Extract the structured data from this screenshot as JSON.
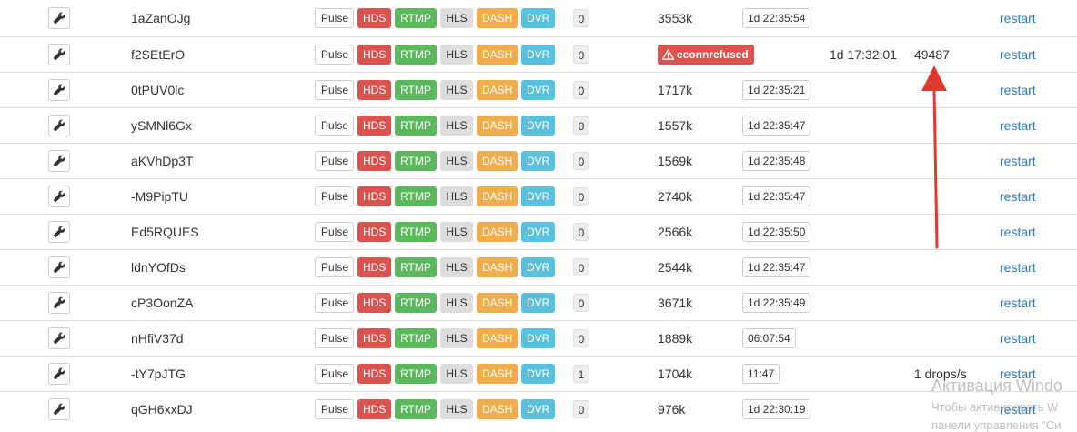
{
  "buttons": {
    "pulse": "Pulse",
    "hds": "HDS",
    "rtmp": "RTMP",
    "hls": "HLS",
    "dash": "DASH",
    "dvr": "DVR"
  },
  "restart_label": "restart",
  "colors": {
    "hds": "#d9534f",
    "rtmp": "#5cb85c",
    "hls": "#dddddd",
    "dash": "#f0ad4e",
    "dvr": "#5bc0de",
    "link": "#337ab7",
    "arrow": "#e03a2f"
  },
  "icons": {
    "settings": "wrench-icon",
    "error": "warning-triangle-icon"
  },
  "streams": [
    {
      "name": "1aZanOJg",
      "clients": "0",
      "bitrate": "3553k",
      "uptime": "1d 22:35:54"
    },
    {
      "name": "f2SEtErO",
      "clients": "0",
      "error": "econnrefused",
      "error_time": "1d 17:32:01",
      "error_code": "49487"
    },
    {
      "name": "0tPUV0lc",
      "clients": "0",
      "bitrate": "1717k",
      "uptime": "1d 22:35:21"
    },
    {
      "name": "ySMNl6Gx",
      "clients": "0",
      "bitrate": "1557k",
      "uptime": "1d 22:35:47"
    },
    {
      "name": "aKVhDp3T",
      "clients": "0",
      "bitrate": "1569k",
      "uptime": "1d 22:35:48"
    },
    {
      "name": "-M9PipTU",
      "clients": "0",
      "bitrate": "2740k",
      "uptime": "1d 22:35:47"
    },
    {
      "name": "Ed5RQUES",
      "clients": "0",
      "bitrate": "2566k",
      "uptime": "1d 22:35:50"
    },
    {
      "name": "ldnYOfDs",
      "clients": "0",
      "bitrate": "2544k",
      "uptime": "1d 22:35:47"
    },
    {
      "name": "cP3OonZA",
      "clients": "0",
      "bitrate": "3671k",
      "uptime": "1d 22:35:49"
    },
    {
      "name": "nHfiV37d",
      "clients": "0",
      "bitrate": "1889k",
      "uptime": "06:07:54"
    },
    {
      "name": "-tY7pJTG",
      "clients": "1",
      "bitrate": "1704k",
      "uptime": "11:47",
      "drops": "1 drops/s"
    },
    {
      "name": "qGH6xxDJ",
      "clients": "0",
      "bitrate": "976k",
      "uptime": "1d 22:30:19"
    }
  ],
  "watermark": {
    "line1": "Активация Windo",
    "line2": "Чтобы активировать W",
    "line3": "панели управления \"Си"
  }
}
